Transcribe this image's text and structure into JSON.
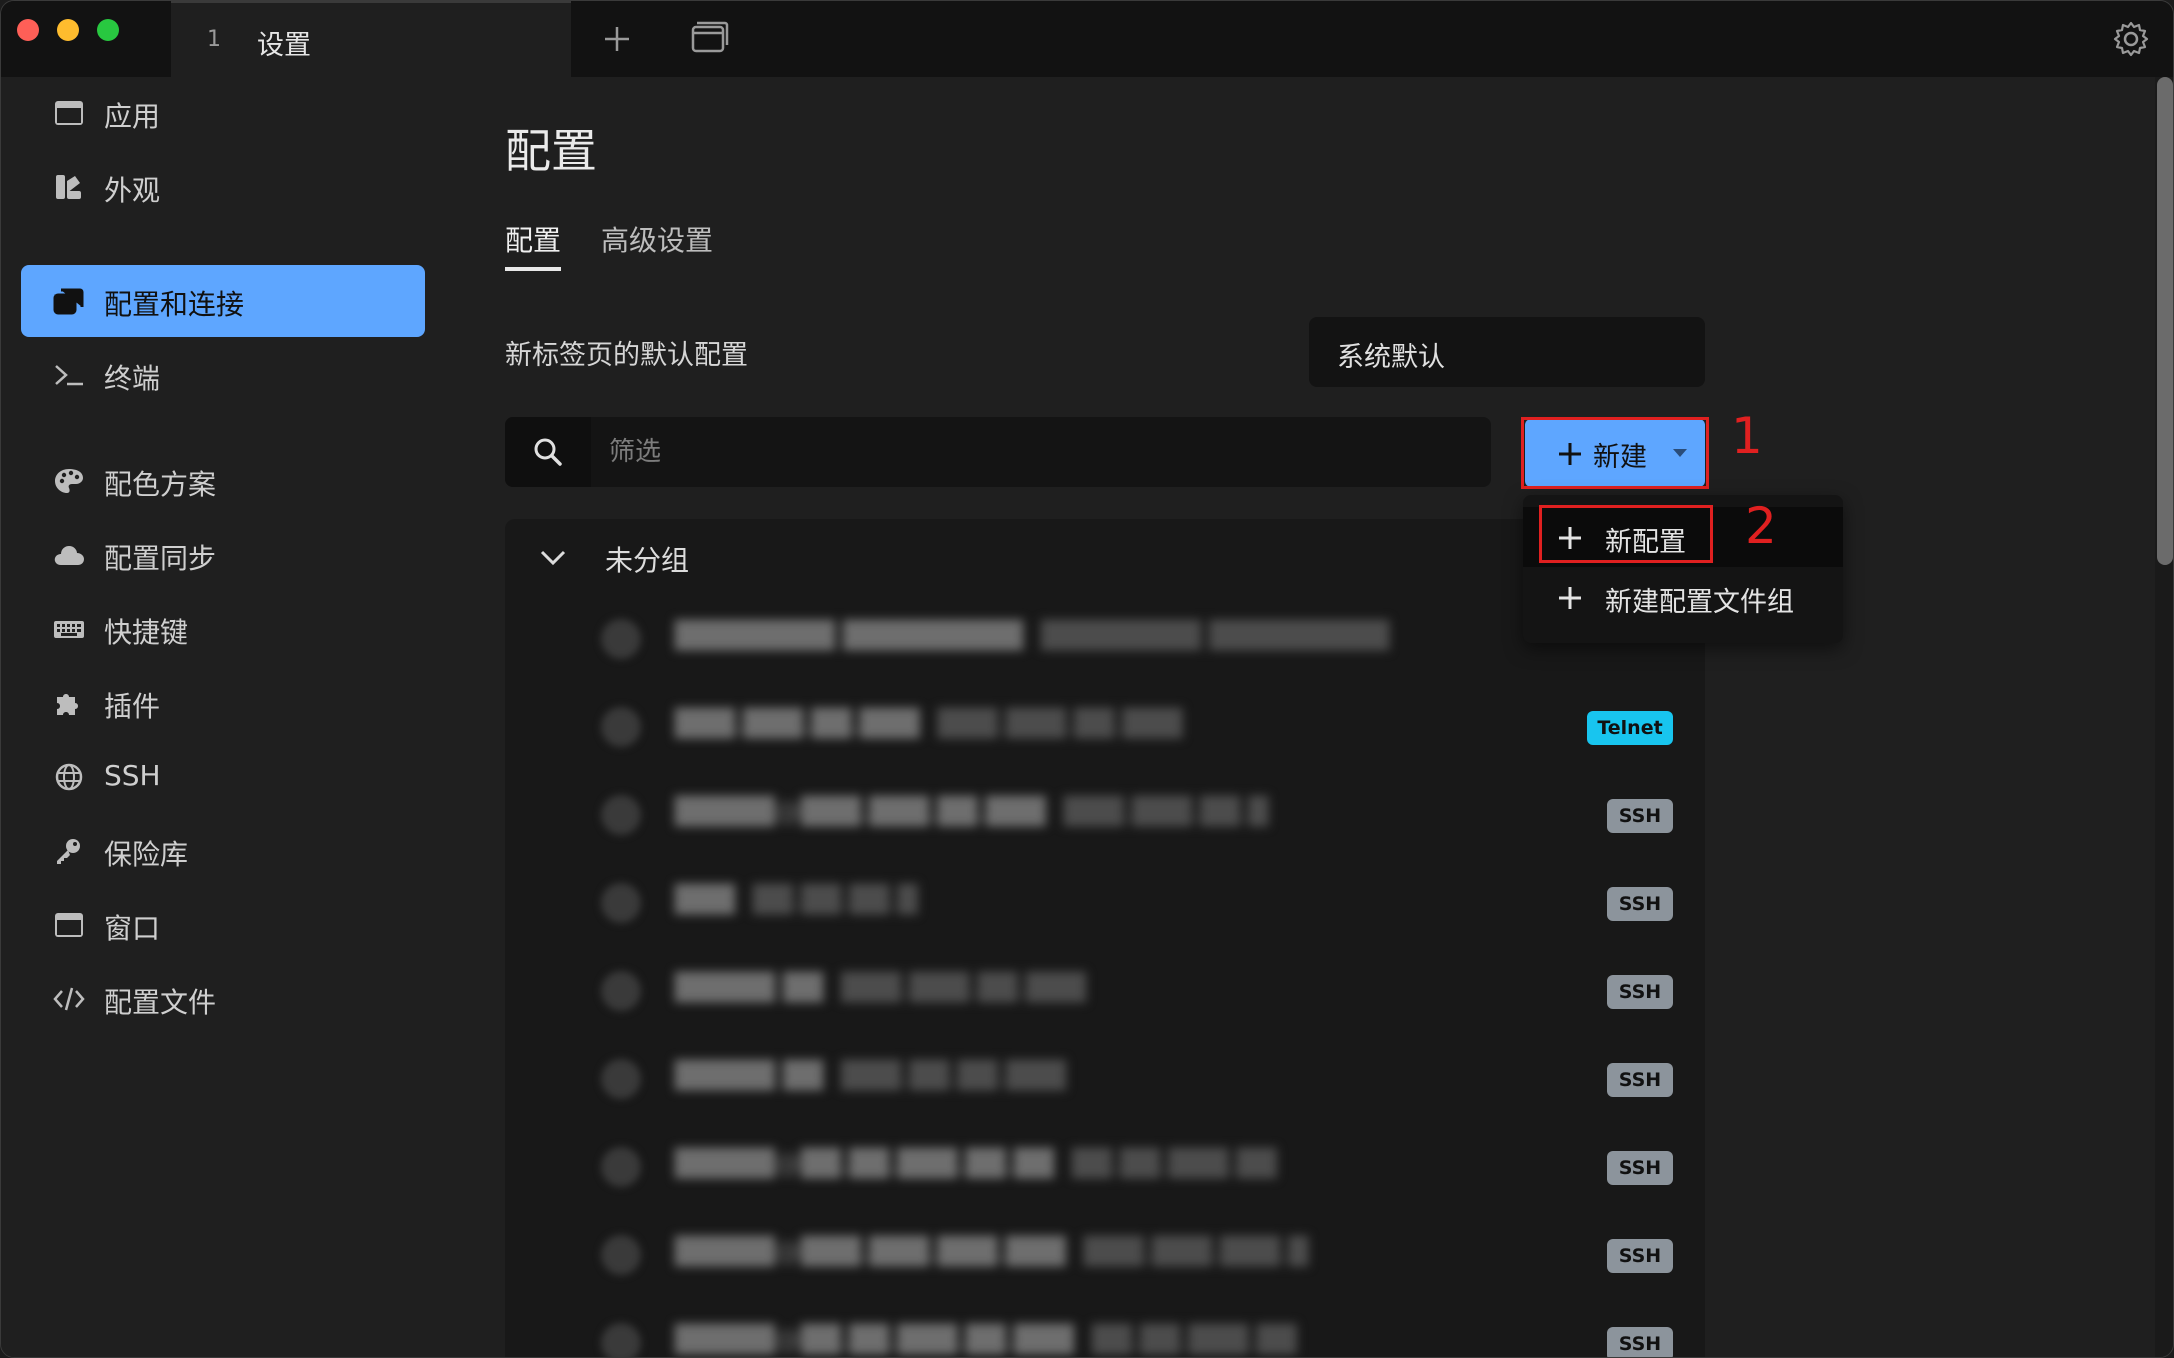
{
  "titlebar": {
    "tab_index": "1",
    "tab_title": "设置"
  },
  "sidebar": {
    "items": [
      {
        "label": "应用",
        "icon": "window-icon"
      },
      {
        "label": "外观",
        "icon": "palette-brush-icon"
      },
      {
        "label": "配置和连接",
        "icon": "windows-stack-icon",
        "active": true
      },
      {
        "label": "终端",
        "icon": "terminal-icon"
      },
      {
        "label": "配色方案",
        "icon": "color-palette-icon"
      },
      {
        "label": "配置同步",
        "icon": "cloud-icon"
      },
      {
        "label": "快捷键",
        "icon": "keyboard-icon"
      },
      {
        "label": "插件",
        "icon": "puzzle-icon"
      },
      {
        "label": "SSH",
        "icon": "globe-icon"
      },
      {
        "label": "保险库",
        "icon": "key-icon"
      },
      {
        "label": "窗口",
        "icon": "window-icon"
      },
      {
        "label": "配置文件",
        "icon": "code-icon"
      }
    ]
  },
  "main": {
    "title": "配置",
    "tabs": [
      {
        "label": "配置",
        "active": true
      },
      {
        "label": "高级设置"
      }
    ],
    "default_profile_label": "新标签页的默认配置",
    "default_profile_value": "系统默认",
    "search": {
      "placeholder": "筛选"
    },
    "new_button_label": "新建",
    "dropdown": {
      "items": [
        {
          "label": "新配置"
        },
        {
          "label": "新建配置文件组"
        }
      ]
    },
    "annotations": {
      "n1": "1",
      "n2": "2"
    },
    "group": {
      "label": "未分组",
      "profiles": [
        {
          "badge": "",
          "badge_type": "local"
        },
        {
          "badge": "Telnet",
          "badge_type": "telnet"
        },
        {
          "badge": "SSH",
          "badge_type": "ssh"
        },
        {
          "badge": "SSH",
          "badge_type": "ssh"
        },
        {
          "badge": "SSH",
          "badge_type": "ssh"
        },
        {
          "badge": "SSH",
          "badge_type": "ssh"
        },
        {
          "badge": "SSH",
          "badge_type": "ssh"
        },
        {
          "badge": "SSH",
          "badge_type": "ssh"
        },
        {
          "badge": "SSH",
          "badge_type": "ssh"
        }
      ]
    }
  },
  "colors": {
    "accent": "#5ea6ff",
    "highlight": "#e02020",
    "telnet": "#18c5ef",
    "ssh": "#8c949c"
  }
}
